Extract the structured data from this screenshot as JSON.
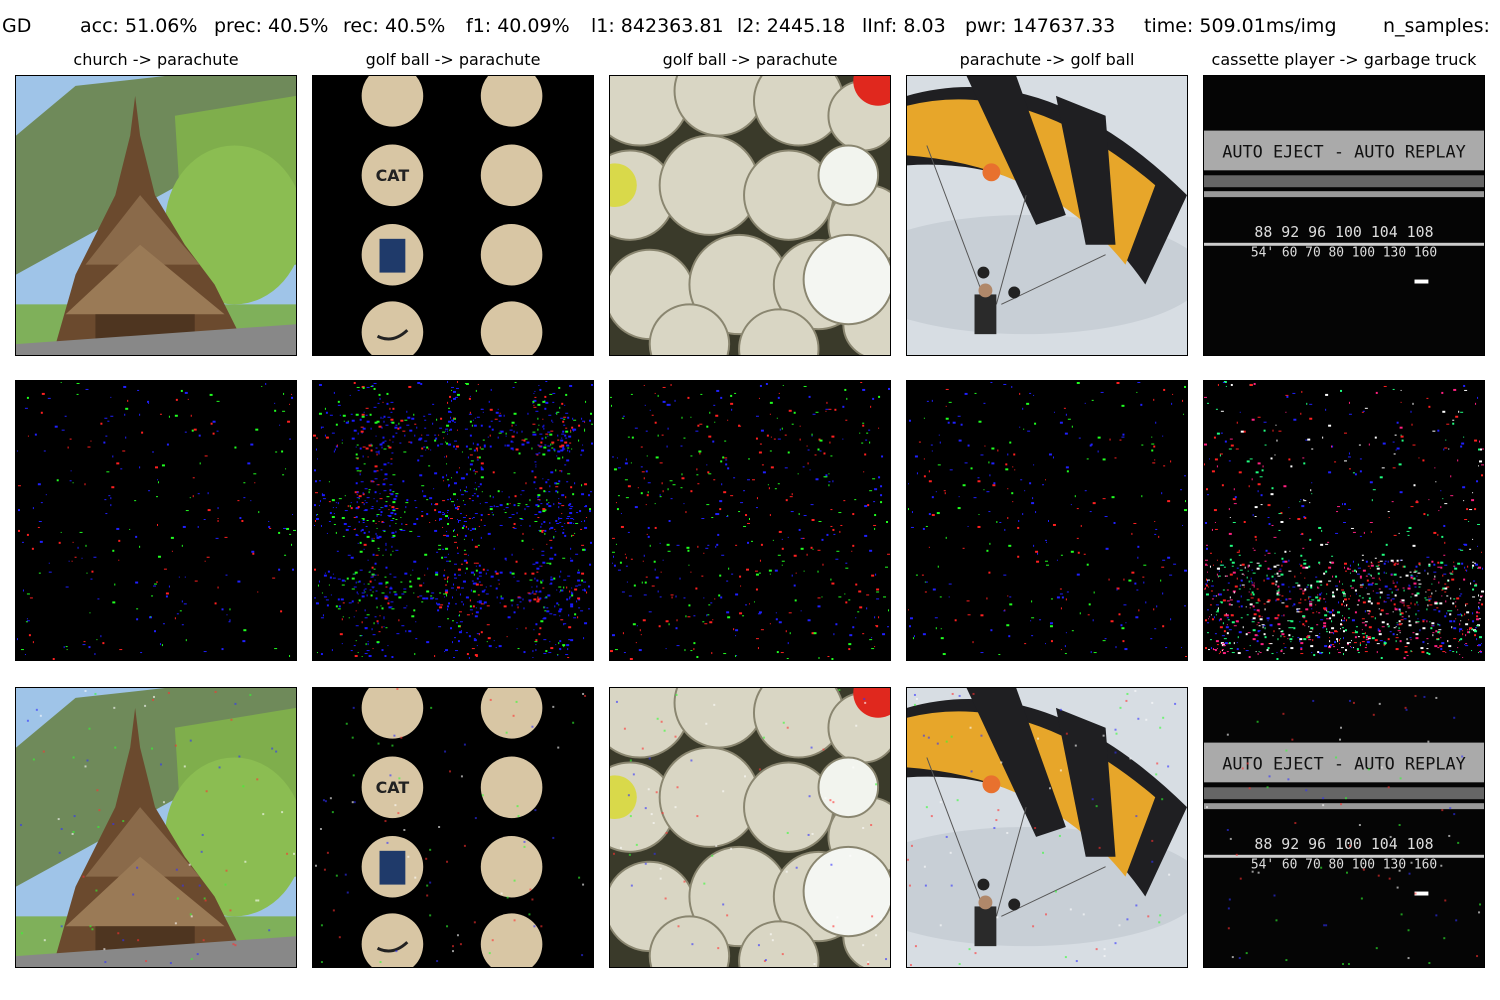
{
  "header": {
    "method": "GD",
    "acc": "acc: 51.06%",
    "prec": "prec: 40.5%",
    "rec": "rec: 40.5%",
    "f1": "f1: 40.09%",
    "l1": "l1: 842363.81",
    "l2": "l2: 2445.18",
    "linf": "lInf: 8.03",
    "pwr": "pwr: 147637.33",
    "time": "time: 509.01ms/img",
    "n_samples": "n_samples:"
  },
  "columns": [
    {
      "title": "church -> parachute",
      "scene": "church"
    },
    {
      "title": "golf ball -> parachute",
      "scene": "golf-ball-grid"
    },
    {
      "title": "golf ball -> parachute",
      "scene": "golf-ball-pile"
    },
    {
      "title": "parachute -> golf ball",
      "scene": "parachute"
    },
    {
      "title": "cassette player -> garbage truck",
      "scene": "cassette-player"
    }
  ],
  "rows": [
    "original",
    "perturbation",
    "adversarial"
  ],
  "panel_text": {
    "cat": "CAT",
    "eject": "AUTO EJECT - AUTO REPLAY",
    "dial_top": "88  92  96  100 104 108",
    "dial_bottom": "54' 60  70  80  100  130  160"
  }
}
